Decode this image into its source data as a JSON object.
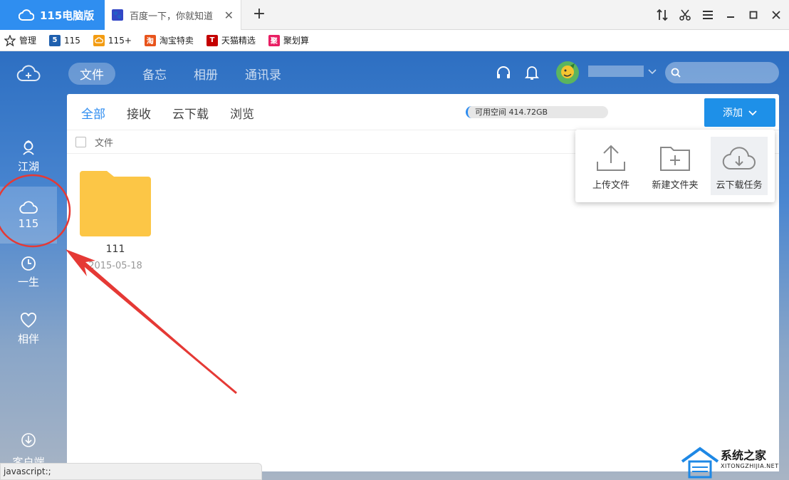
{
  "browser": {
    "active_tab_label": "115电脑版",
    "second_tab_label": "百度一下，你就知道",
    "new_tab_symbol": "+",
    "close_symbol": "✕"
  },
  "bookmarks": [
    {
      "label": "管理",
      "color": "#ffffff"
    },
    {
      "label": "115",
      "icon_text": "5",
      "color": "#1e5fae"
    },
    {
      "label": "115+",
      "color": "#f39c12"
    },
    {
      "label": "淘宝特卖",
      "icon_text": "淘",
      "color": "#e8541c"
    },
    {
      "label": "天猫精选",
      "icon_text": "T",
      "color": "#c40000"
    },
    {
      "label": "聚划算",
      "icon_text": "聚",
      "color": "#e91e63"
    }
  ],
  "sidebar": {
    "items": [
      {
        "label": "江湖"
      },
      {
        "label": "115"
      },
      {
        "label": "一生"
      },
      {
        "label": "相伴"
      }
    ],
    "client_label": "客户端"
  },
  "topnav": {
    "tabs": [
      "文件",
      "备忘",
      "相册",
      "通讯录"
    ]
  },
  "panel": {
    "subtabs": [
      "全部",
      "接收",
      "云下载",
      "浏览"
    ],
    "space_text": "可用空间 414.72GB",
    "add_button": "添加",
    "column_header": "文件",
    "folder": {
      "name": "111",
      "date": "2015-05-18"
    }
  },
  "dropdown": {
    "items": [
      "上传文件",
      "新建文件夹",
      "云下载任务"
    ]
  },
  "statusbar": {
    "text": "javascript:;"
  },
  "watermark": {
    "title": "系统之家",
    "subtitle": "XITONGZHIJIA.NET"
  },
  "colors": {
    "accent": "#2d8cf0",
    "annotation": "#e53935",
    "folder": "#fcc646"
  }
}
